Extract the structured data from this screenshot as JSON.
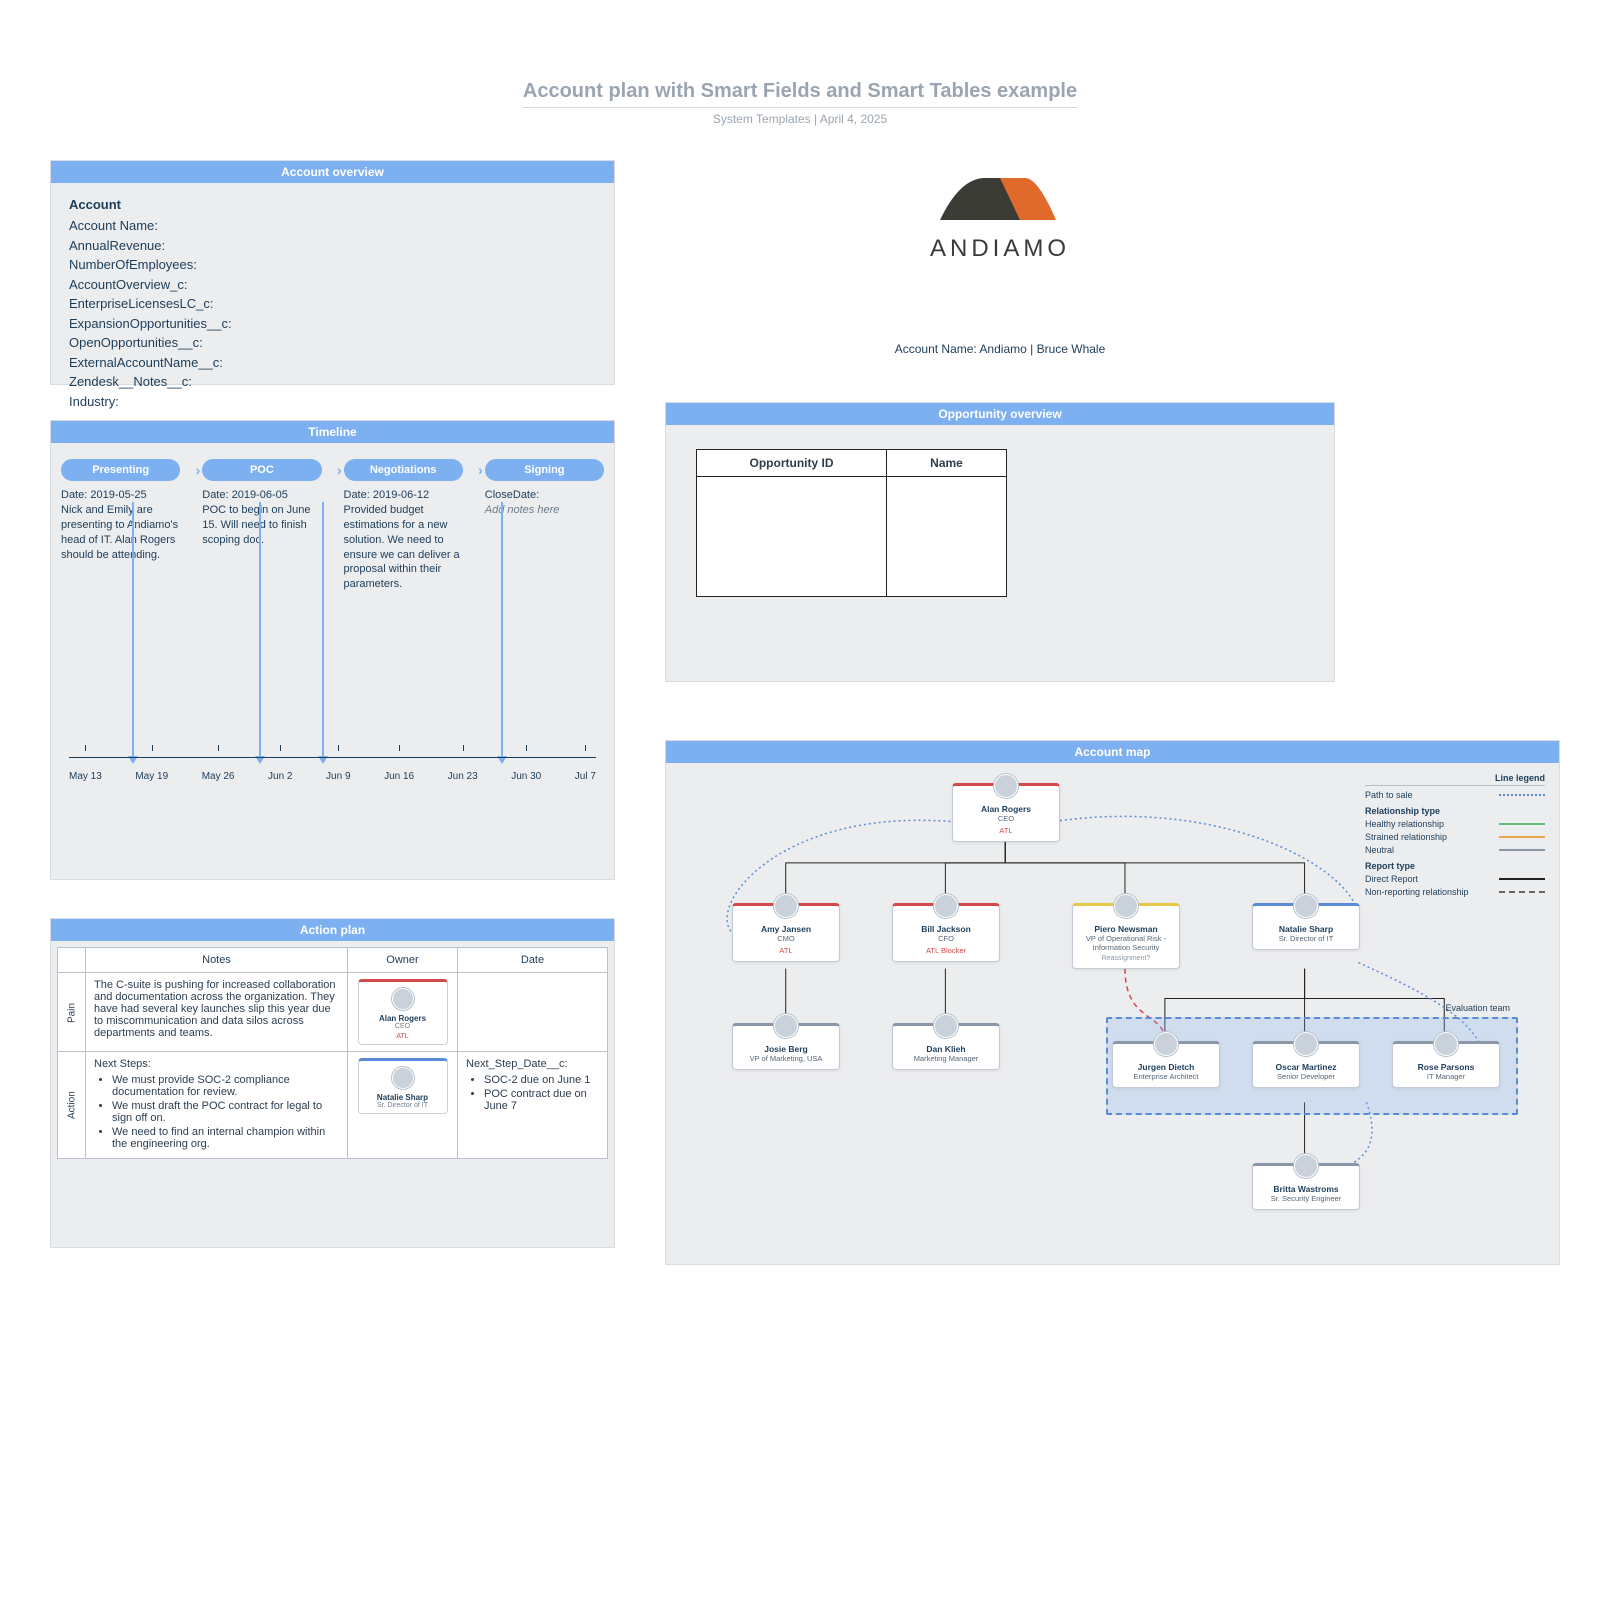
{
  "page": {
    "title": "Account plan with Smart Fields and Smart Tables example",
    "subtitle": "System Templates   |   April 4, 2025"
  },
  "account_overview": {
    "header": "Account overview",
    "title": "Account",
    "fields": [
      "Account Name:",
      "AnnualRevenue:",
      "NumberOfEmployees:",
      "AccountOverview_c:",
      "EnterpriseLicensesLC_c:",
      "ExpansionOpportunities__c:",
      "OpenOpportunities__c:",
      "ExternalAccountName__c:",
      "Zendesk__Notes__c:",
      "Industry:"
    ]
  },
  "timeline": {
    "header": "Timeline",
    "stages": [
      {
        "label": "Presenting",
        "date": "Date: 2019-05-25",
        "note": "Nick and Emily are presenting to Andiamo's head of IT. Alan Rogers should be attending."
      },
      {
        "label": "POC",
        "date": "Date: 2019-06-05",
        "note": "POC to begin on June 15. Will need to finish scoping doc."
      },
      {
        "label": "Negotiations",
        "date": "Date: 2019-06-12",
        "note": "Provided budget estimations for a new solution. We need to ensure we can deliver a proposal within their parameters."
      },
      {
        "label": "Signing",
        "date": "CloseDate:",
        "note": "Add notes here",
        "italic": true
      }
    ],
    "ticks": [
      "May 13",
      "May 19",
      "May 26",
      "Jun 2",
      "Jun 9",
      "Jun 16",
      "Jun 23",
      "Jun 30",
      "Jul 7"
    ],
    "vlines_pct": [
      12,
      36,
      48,
      82
    ]
  },
  "action_plan": {
    "header": "Action plan",
    "cols": [
      "Notes",
      "Owner",
      "Date"
    ],
    "rows": [
      {
        "label": "Pain",
        "notes": "The C-suite is pushing for increased collaboration and documentation across the organization. They have had several key launches slip this year due to miscommunication and data silos across departments and teams.",
        "owner": {
          "name": "Alan Rogers",
          "role": "CEO",
          "tag": "ATL",
          "color": "red"
        },
        "date": ""
      },
      {
        "label": "Action",
        "notes_title": "Next Steps:",
        "notes_list": [
          "We must provide SOC-2 compliance documentation for review.",
          "We must draft the POC contract for legal to sign off on.",
          "We need to find an internal champion within the engineering org."
        ],
        "owner": {
          "name": "Natalie Sharp",
          "role": "Sr. Director of IT",
          "tag": "",
          "color": "blue"
        },
        "date_title": "Next_Step_Date__c:",
        "date_list": [
          "SOC-2 due on June 1",
          "POC contract due on June 7"
        ]
      }
    ]
  },
  "logo": {
    "brand": "ANDIAMO",
    "account_line": "Account Name:  Andiamo |  Bruce Whale"
  },
  "opportunity": {
    "header": "Opportunity overview",
    "cols": [
      "Opportunity ID",
      "Name"
    ]
  },
  "account_map": {
    "header": "Account map",
    "legend": {
      "title": "Line legend",
      "path_to_sale": "Path to sale",
      "rel_header": "Relationship type",
      "rel_healthy": "Healthy relationship",
      "rel_strained": "Strained relationship",
      "rel_neutral": "Neutral",
      "rep_header": "Report type",
      "rep_direct": "Direct Report",
      "rep_nonrep": "Non-reporting relationship"
    },
    "eval_team_label": "Evaluation team",
    "nodes": {
      "ceo": {
        "name": "Alan Rogers",
        "role": "CEO",
        "tag": "ATL"
      },
      "cmo": {
        "name": "Amy Jansen",
        "role": "CMO",
        "tag": "ATL"
      },
      "cfo": {
        "name": "Bill Jackson",
        "role": "CFO",
        "tag": "ATL Blocker"
      },
      "vprisk": {
        "name": "Piero Newsman",
        "role": "VP of Operational Risk - Information Security",
        "prompt": "Reassignment?"
      },
      "srit": {
        "name": "Natalie Sharp",
        "role": "Sr. Director of IT"
      },
      "vpmkt": {
        "name": "Josie Berg",
        "role": "VP of Marketing, USA"
      },
      "mmgr": {
        "name": "Dan Klieh",
        "role": "Marketing Manager"
      },
      "earch": {
        "name": "Jurgen Dietch",
        "role": "Enterprise Architect"
      },
      "sdev": {
        "name": "Oscar Martinez",
        "role": "Senior Developer"
      },
      "itmgr": {
        "name": "Rose Parsons",
        "role": "IT Manager"
      },
      "seceng": {
        "name": "Britta Wastroms",
        "role": "Sr. Security Engineer"
      }
    }
  }
}
